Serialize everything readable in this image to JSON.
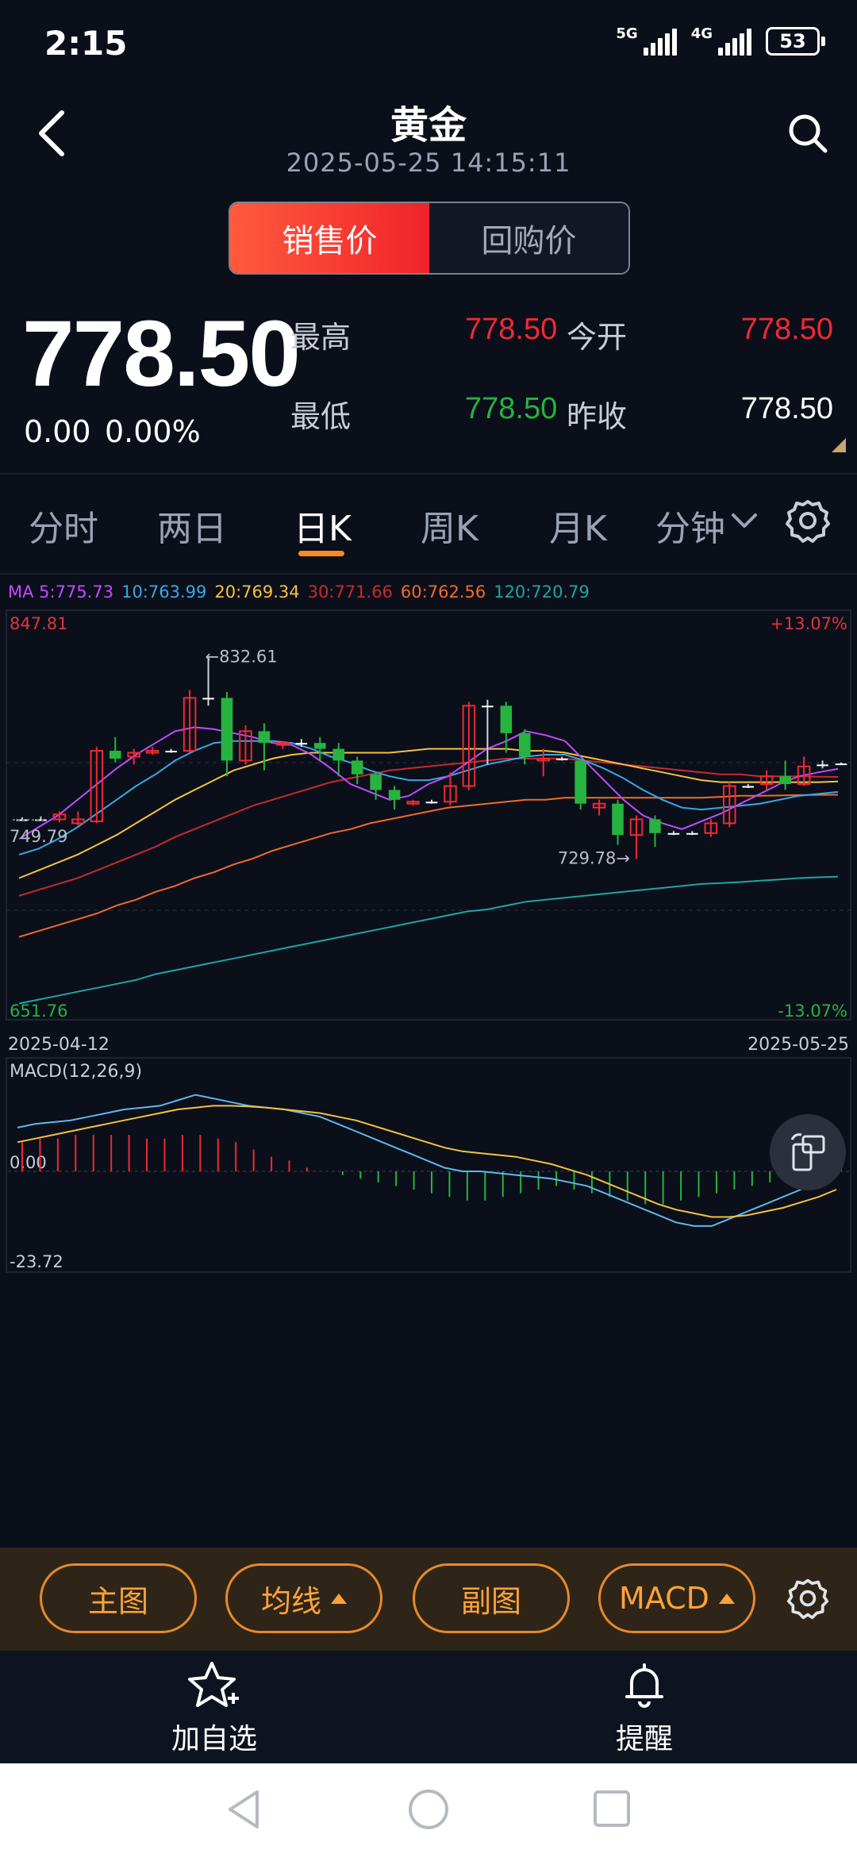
{
  "status_bar": {
    "time": "2:15",
    "net1": "5G",
    "net2": "4G",
    "battery": "53"
  },
  "header": {
    "title": "黄金",
    "timestamp": "2025-05-25 14:15:11"
  },
  "price_type": {
    "active": "销售价",
    "inactive": "回购价"
  },
  "quote": {
    "price": "778.50",
    "change": "0.00",
    "change_pct": "0.00%",
    "high_label": "最高",
    "high": "778.50",
    "open_label": "今开",
    "open": "778.50",
    "low_label": "最低",
    "low": "778.50",
    "prev_close_label": "昨收",
    "prev_close": "778.50"
  },
  "tabs": [
    {
      "label": "分时"
    },
    {
      "label": "两日"
    },
    {
      "label": "日K"
    },
    {
      "label": "周K"
    },
    {
      "label": "月K"
    },
    {
      "label": "分钟"
    }
  ],
  "colors": {
    "up": "#f02a34",
    "down": "#27b340",
    "accent": "#ff8a1e",
    "ma5": "#c04cff",
    "ma10": "#38a8e8",
    "ma20": "#f3c23f",
    "ma30": "#c72b2b",
    "ma60": "#f06a2c",
    "ma120": "#1fa6a0"
  },
  "chart_data": {
    "type": "candlestick",
    "ma_legend": [
      {
        "name": "MA 5",
        "label": "MA 5:775.73",
        "color": "#c04cff"
      },
      {
        "name": "10",
        "label": "10:763.99",
        "color": "#38a8e8"
      },
      {
        "name": "20",
        "label": "20:769.34",
        "color": "#f3c23f"
      },
      {
        "name": "30",
        "label": "30:771.66",
        "color": "#c72b2b"
      },
      {
        "name": "60",
        "label": "60:762.56",
        "color": "#f06a2c"
      },
      {
        "name": "120",
        "label": "120:720.79",
        "color": "#1fa6a0"
      }
    ],
    "y_max_label": "847.81",
    "y_min_label": "651.76",
    "pct_max_label": "+13.07%",
    "pct_min_label": "-13.07%",
    "ylim": [
      651.76,
      847.81
    ],
    "x_start_label": "2025-04-12",
    "x_end_label": "2025-05-25",
    "annotations": {
      "high": "←832.61",
      "low": "729.78→",
      "left_price": "749.79"
    },
    "high_value": 832.61,
    "low_value": 729.78,
    "left_value": 749.79,
    "candles": [
      {
        "o": 750.0,
        "c": 750.0,
        "h": 751.0,
        "l": 749.5
      },
      {
        "o": 750.0,
        "c": 750.0,
        "h": 751.5,
        "l": 749.5
      },
      {
        "o": 750.0,
        "c": 752.5,
        "h": 754.0,
        "l": 748.5
      },
      {
        "o": 748.0,
        "c": 750.0,
        "h": 754.0,
        "l": 747.0
      },
      {
        "o": 749.0,
        "c": 785.0,
        "h": 787.0,
        "l": 748.0
      },
      {
        "o": 785.0,
        "c": 781.0,
        "h": 792.0,
        "l": 779.0
      },
      {
        "o": 782.0,
        "c": 784.0,
        "h": 786.0,
        "l": 778.0
      },
      {
        "o": 784.0,
        "c": 785.0,
        "h": 787.0,
        "l": 783.0
      },
      {
        "o": 785.0,
        "c": 785.0,
        "h": 786.0,
        "l": 784.0
      },
      {
        "o": 785.0,
        "c": 812.0,
        "h": 816.0,
        "l": 784.0
      },
      {
        "o": 812.0,
        "c": 812.0,
        "h": 832.61,
        "l": 808.0
      },
      {
        "o": 812.0,
        "c": 780.0,
        "h": 815.0,
        "l": 772.0
      },
      {
        "o": 780.0,
        "c": 795.0,
        "h": 798.0,
        "l": 778.0
      },
      {
        "o": 795.0,
        "c": 789.0,
        "h": 799.0,
        "l": 775.0
      },
      {
        "o": 788.0,
        "c": 789.0,
        "h": 790.0,
        "l": 786.0
      },
      {
        "o": 789.0,
        "c": 789.0,
        "h": 791.0,
        "l": 787.0
      },
      {
        "o": 789.0,
        "c": 786.0,
        "h": 792.0,
        "l": 780.0
      },
      {
        "o": 786.0,
        "c": 780.0,
        "h": 789.0,
        "l": 772.0
      },
      {
        "o": 780.0,
        "c": 773.0,
        "h": 782.0,
        "l": 768.0
      },
      {
        "o": 773.0,
        "c": 765.0,
        "h": 774.0,
        "l": 760.0
      },
      {
        "o": 765.0,
        "c": 760.0,
        "h": 767.0,
        "l": 755.0
      },
      {
        "o": 758.0,
        "c": 759.0,
        "h": 760.0,
        "l": 757.0
      },
      {
        "o": 759.0,
        "c": 759.0,
        "h": 760.0,
        "l": 758.0
      },
      {
        "o": 759.0,
        "c": 767.0,
        "h": 774.0,
        "l": 757.0
      },
      {
        "o": 767.0,
        "c": 808.0,
        "h": 810.0,
        "l": 765.0
      },
      {
        "o": 808.0,
        "c": 808.0,
        "h": 811.0,
        "l": 778.0
      },
      {
        "o": 808.0,
        "c": 794.0,
        "h": 810.0,
        "l": 784.0
      },
      {
        "o": 794.0,
        "c": 782.0,
        "h": 796.0,
        "l": 778.0
      },
      {
        "o": 780.0,
        "c": 781.0,
        "h": 786.0,
        "l": 772.0
      },
      {
        "o": 781.0,
        "c": 781.0,
        "h": 782.0,
        "l": 780.0
      },
      {
        "o": 780.0,
        "c": 758.0,
        "h": 781.0,
        "l": 755.0
      },
      {
        "o": 756.0,
        "c": 758.0,
        "h": 760.0,
        "l": 752.0
      },
      {
        "o": 758.0,
        "c": 742.0,
        "h": 760.0,
        "l": 737.0
      },
      {
        "o": 742.0,
        "c": 750.0,
        "h": 752.0,
        "l": 729.78
      },
      {
        "o": 750.0,
        "c": 743.0,
        "h": 752.0,
        "l": 736.0
      },
      {
        "o": 743.0,
        "c": 743.0,
        "h": 744.0,
        "l": 742.0
      },
      {
        "o": 743.0,
        "c": 743.0,
        "h": 744.0,
        "l": 742.0
      },
      {
        "o": 743.0,
        "c": 748.0,
        "h": 750.0,
        "l": 741.0
      },
      {
        "o": 748.0,
        "c": 767.0,
        "h": 769.0,
        "l": 746.0
      },
      {
        "o": 767.0,
        "c": 767.0,
        "h": 768.0,
        "l": 766.0
      },
      {
        "o": 768.0,
        "c": 772.0,
        "h": 775.0,
        "l": 765.0
      },
      {
        "o": 772.0,
        "c": 768.0,
        "h": 780.0,
        "l": 765.0
      },
      {
        "o": 768.0,
        "c": 777.0,
        "h": 782.0,
        "l": 767.0
      },
      {
        "o": 778.0,
        "c": 778.0,
        "h": 780.0,
        "l": 776.0
      },
      {
        "o": 778.5,
        "c": 778.5,
        "h": 779.0,
        "l": 778.0
      }
    ],
    "ma": {
      "ma5": [
        740,
        746,
        752,
        760,
        768,
        776,
        783,
        789,
        795,
        797,
        796,
        794,
        792,
        789,
        788,
        783,
        776,
        768,
        764,
        760,
        762,
        768,
        772,
        779,
        786,
        790,
        795,
        793,
        790,
        780,
        770,
        760,
        752,
        748,
        745,
        749,
        753,
        758,
        763,
        768,
        772,
        774,
        775.73
      ],
      "ma10": [
        732,
        735,
        740,
        746,
        753,
        760,
        767,
        773,
        780,
        785,
        789,
        790,
        790,
        790,
        789,
        786,
        782,
        779,
        775,
        772,
        770,
        770,
        772,
        775,
        778,
        780,
        782,
        783,
        783,
        780,
        776,
        771,
        765,
        760,
        756,
        755,
        756,
        757,
        758,
        760,
        762,
        763,
        763.99
      ],
      "ma20": [
        720,
        724,
        728,
        732,
        737,
        742,
        748,
        754,
        760,
        765,
        770,
        775,
        778,
        781,
        783,
        784,
        784,
        784,
        784,
        784,
        785,
        786,
        786,
        786,
        786,
        786,
        785,
        785,
        784,
        782,
        780,
        778,
        776,
        774,
        772,
        770,
        769,
        769,
        769,
        769,
        769,
        769,
        769.34
      ],
      "ma30": [
        711,
        714,
        717,
        720,
        724,
        728,
        732,
        736,
        741,
        745,
        749,
        753,
        757,
        760,
        763,
        766,
        769,
        771,
        773,
        775,
        776,
        777,
        778,
        779,
        780,
        781,
        781,
        781,
        781,
        780,
        779,
        778,
        777,
        776,
        775,
        774,
        773,
        773,
        772,
        772,
        772,
        771.8,
        771.66
      ],
      "ma60": [
        690,
        693,
        696,
        699,
        702,
        706,
        709,
        713,
        716,
        720,
        723,
        727,
        730,
        734,
        737,
        740,
        743,
        745,
        748,
        750,
        752,
        754,
        756,
        757,
        758,
        759,
        760,
        760,
        761,
        761,
        761,
        761,
        761,
        761,
        761,
        761,
        761.5,
        762,
        762,
        762.2,
        762.4,
        762.5,
        762.56
      ],
      "ma120": [
        656,
        658,
        660,
        662,
        664,
        666,
        668,
        671,
        673,
        675,
        677,
        679,
        681,
        683,
        685,
        687,
        689,
        691,
        693,
        695,
        697,
        699,
        701,
        703,
        704,
        706,
        708,
        709,
        710,
        711,
        712,
        713,
        714,
        715,
        716,
        717,
        717.5,
        718,
        718.7,
        719.3,
        720,
        720.4,
        720.79
      ]
    },
    "macd": {
      "label": "MACD(12,26,9)",
      "ylim": [
        -23.72,
        22.0
      ],
      "zero_label": "0.00",
      "min_label": "-23.72",
      "dif": [
        12,
        13,
        13.5,
        14,
        15,
        16,
        17,
        17.5,
        18,
        19.5,
        21,
        20,
        19,
        18,
        17.5,
        17,
        16,
        15,
        13,
        11,
        9,
        7,
        5,
        3,
        1,
        0,
        0,
        -0.5,
        -1,
        -1.5,
        -2,
        -3,
        -4,
        -6,
        -8,
        -10,
        -12,
        -14,
        -15,
        -15,
        -13,
        -11,
        -9,
        -7,
        -5,
        -3,
        -1
      ],
      "dea": [
        8,
        9,
        10,
        11,
        12,
        13,
        14,
        15,
        16,
        17,
        17.5,
        18,
        18,
        17.8,
        17.5,
        17,
        16.5,
        16,
        15,
        14,
        12.5,
        11,
        9.5,
        8,
        6.5,
        5.5,
        5,
        4.5,
        4,
        3,
        2,
        0.5,
        -1,
        -3,
        -5,
        -7,
        -9,
        -10.5,
        -11.5,
        -12.5,
        -12.5,
        -12,
        -11,
        -10,
        -8.5,
        -7,
        -5
      ],
      "hist": [
        8,
        9,
        9,
        10,
        10,
        10,
        10,
        9,
        9,
        10,
        10,
        9,
        8,
        6,
        4,
        3,
        1,
        0,
        -1,
        -2,
        -3,
        -4,
        -5,
        -6,
        -7,
        -8,
        -8,
        -7,
        -6,
        -5,
        -4,
        -5,
        -6,
        -7,
        -8,
        -9,
        -9,
        -8,
        -7,
        -6,
        -5,
        -4,
        -3,
        -2,
        1,
        2,
        3
      ]
    }
  },
  "toolbar": {
    "main_chart": "主图",
    "ma_lines": "均线",
    "sub_chart": "副图",
    "indicator": "MACD"
  },
  "bottom_nav": {
    "watchlist": "加自选",
    "alert": "提醒"
  }
}
